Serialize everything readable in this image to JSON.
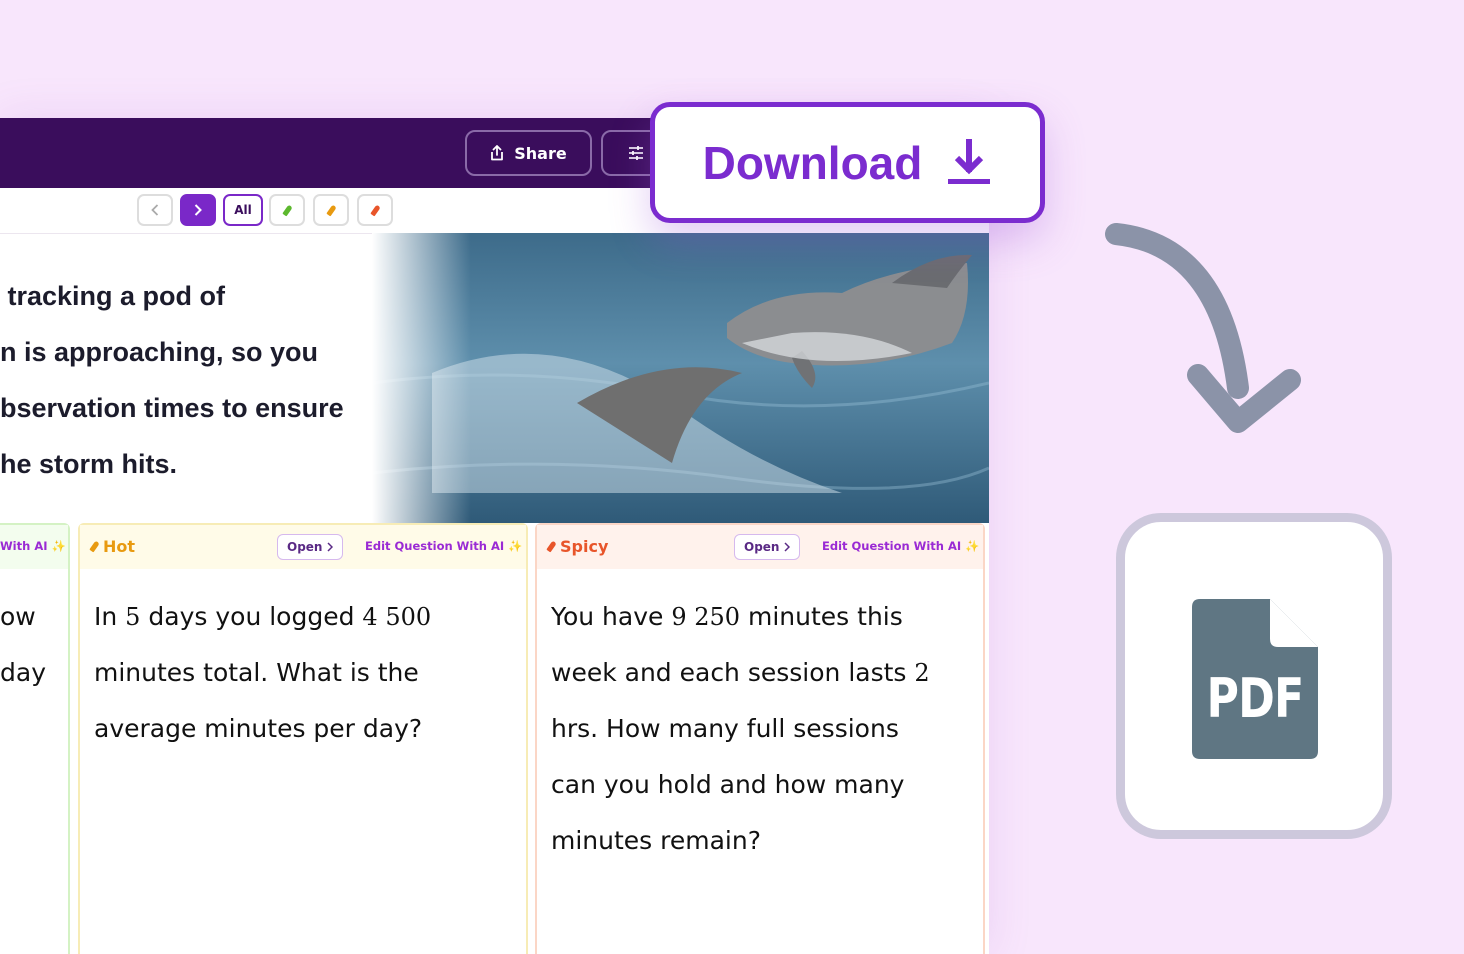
{
  "header": {
    "share_label": "Share"
  },
  "filters": {
    "all_label": "All"
  },
  "prompt": {
    "lines": [
      " tracking a pod of",
      "n is approaching, so you",
      "bservation times to ensure",
      "he storm hits."
    ]
  },
  "cards": {
    "mild": {
      "edit_label": "With AI",
      "lines": [
        "ow",
        "day"
      ]
    },
    "hot": {
      "level_label": "Hot",
      "open_label": "Open",
      "edit_label": "Edit Question With AI",
      "line1_pre": "In ",
      "num1": "5",
      "line1_mid": " days you logged ",
      "num2": "4 500",
      "line2": "minutes total. What is the",
      "line3": "average minutes per day?"
    },
    "spicy": {
      "level_label": "Spicy",
      "open_label": "Open",
      "edit_label": "Edit Question With AI",
      "line1_pre": "You have ",
      "num1": "9 250",
      "line1_post": " minutes this",
      "line2_pre": "week and each session lasts ",
      "num2": "2",
      "line3": "hrs. How many full sessions",
      "line4": "can you hold and how many",
      "line5": "minutes remain?"
    }
  },
  "callout": {
    "download_label": "Download"
  },
  "pdf": {
    "label": "PDF"
  },
  "colors": {
    "accent": "#7b2ccf",
    "header_bg": "#3a0d5c",
    "page_bg": "#f8e6fc",
    "mild": "#5cb82e",
    "hot": "#e89a10",
    "spicy": "#e8552a"
  },
  "icons": [
    "share-icon",
    "sliders-icon",
    "chevron-left-icon",
    "chevron-right-icon",
    "chili-pepper-icon",
    "sparkle-icon",
    "download-icon",
    "curved-arrow-icon",
    "pdf-file-icon"
  ]
}
